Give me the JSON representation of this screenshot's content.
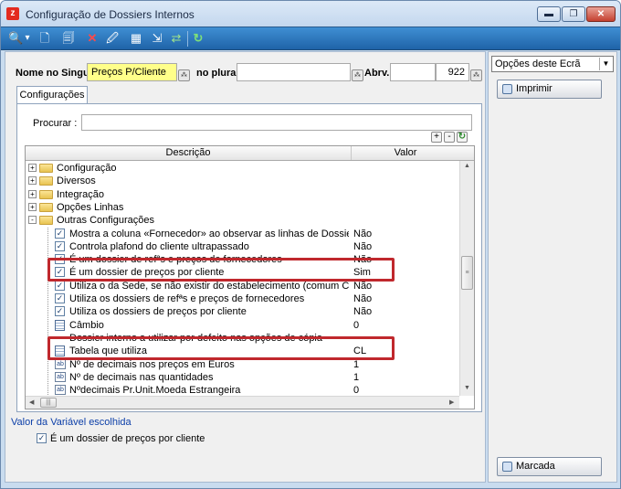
{
  "window": {
    "title": "Configuração de Dossiers Internos",
    "app_icon_glyph": "z",
    "minimize_glyph": "▬",
    "maximize_glyph": "❐",
    "close_glyph": "✕"
  },
  "toolbar": {
    "icons": [
      "search-icon",
      "dropdown-arrow-icon",
      "new-document-icon",
      "copy-document-icon",
      "delete-icon",
      "edit-document-icon",
      "grid-icon",
      "export-icon",
      "transfer-icon",
      "refresh-icon"
    ],
    "glyphs": {
      "search": "🔍",
      "dropdown": "▾",
      "new": "🗋",
      "copy": "🗐",
      "delete": "✕",
      "edit": "🖉",
      "grid": "▦",
      "export": "⇲",
      "transfer": "⇄",
      "refresh": "↻"
    }
  },
  "form": {
    "singular_label": "Nome no Singular",
    "singular_value": "Preços P/Cliente",
    "plural_label": "no plural",
    "plural_value": "",
    "abrv_label": "Abrv.",
    "abrv_value": "",
    "id_value": "922",
    "lookup_glyph": "⁂"
  },
  "tabs": [
    {
      "label": "Configurações"
    }
  ],
  "search": {
    "label": "Procurar :",
    "value": ""
  },
  "grid_buttons": {
    "add": "+",
    "remove": "-",
    "refresh": "↻"
  },
  "grid": {
    "headers": {
      "description": "Descrição",
      "value": "Valor"
    },
    "rows": [
      {
        "type": "folder",
        "expander": "+",
        "label": "Configuração",
        "value": ""
      },
      {
        "type": "folder",
        "expander": "+",
        "label": "Diversos",
        "value": ""
      },
      {
        "type": "folder",
        "expander": "+",
        "label": "Integração",
        "value": ""
      },
      {
        "type": "folder",
        "expander": "+",
        "label": "Opções Linhas",
        "value": ""
      },
      {
        "type": "folder",
        "expander": "-",
        "label": "Outras Configurações",
        "value": ""
      },
      {
        "type": "check",
        "label": "Mostra a coluna «Fornecedor» ao observar as linhas de Dossiers a p...",
        "value": "Não"
      },
      {
        "type": "check",
        "label": "Controla plafond do cliente ultrapassado",
        "value": "Não"
      },
      {
        "type": "check",
        "label": "É um dossier de refªs e preços de fornecedores",
        "value": "Não"
      },
      {
        "type": "check",
        "label": "É um dossier de preços por cliente",
        "value": "Sim"
      },
      {
        "type": "check",
        "label": "Utiliza o da Sede, se não existir do estabelecimento (comum Clientes)",
        "value": "Não"
      },
      {
        "type": "check",
        "label": "Utiliza os dossiers de refªs e preços de fornecedores",
        "value": "Não"
      },
      {
        "type": "check",
        "label": "Utiliza os dossiers de preços por cliente",
        "value": "Não"
      },
      {
        "type": "calc",
        "label": "Câmbio",
        "value": "0"
      },
      {
        "type": "text",
        "label": "Dossier interno a utilizar por defeito nas opções de cópia",
        "value": ""
      },
      {
        "type": "calc",
        "label": "Tabela que utiliza",
        "value": "CL"
      },
      {
        "type": "ab",
        "label": "Nº de decimais nos preços em Euros",
        "value": "1"
      },
      {
        "type": "ab",
        "label": "Nº de decimais nas quantidades",
        "value": "1"
      },
      {
        "type": "ab",
        "label": "Nºdecimais Pr.Unit.Moeda Estrangeira",
        "value": "0"
      }
    ],
    "check_glyph": "✓",
    "ab_glyph": "ab",
    "scroll_glyphs": {
      "up": "▲",
      "down": "▼",
      "left": "◀",
      "right": "▶",
      "grip_v": "≡",
      "grip_h": "|||"
    }
  },
  "bottom": {
    "variable_link": "Valor da Variável escolhida",
    "variable_checkbox_label": "É um dossier de preços por cliente",
    "variable_checked": true
  },
  "side_panel": {
    "dropdown_value": "Opções deste Ecrã",
    "dropdown_arrow": "▼",
    "print_button": "Imprimir",
    "brand_button": "Marcada"
  },
  "colors": {
    "highlight_box": "#c0282d",
    "field_yellow": "#ffff8a",
    "toolbar_blue": "#1f63a8",
    "link_blue": "#0b3ea8"
  }
}
